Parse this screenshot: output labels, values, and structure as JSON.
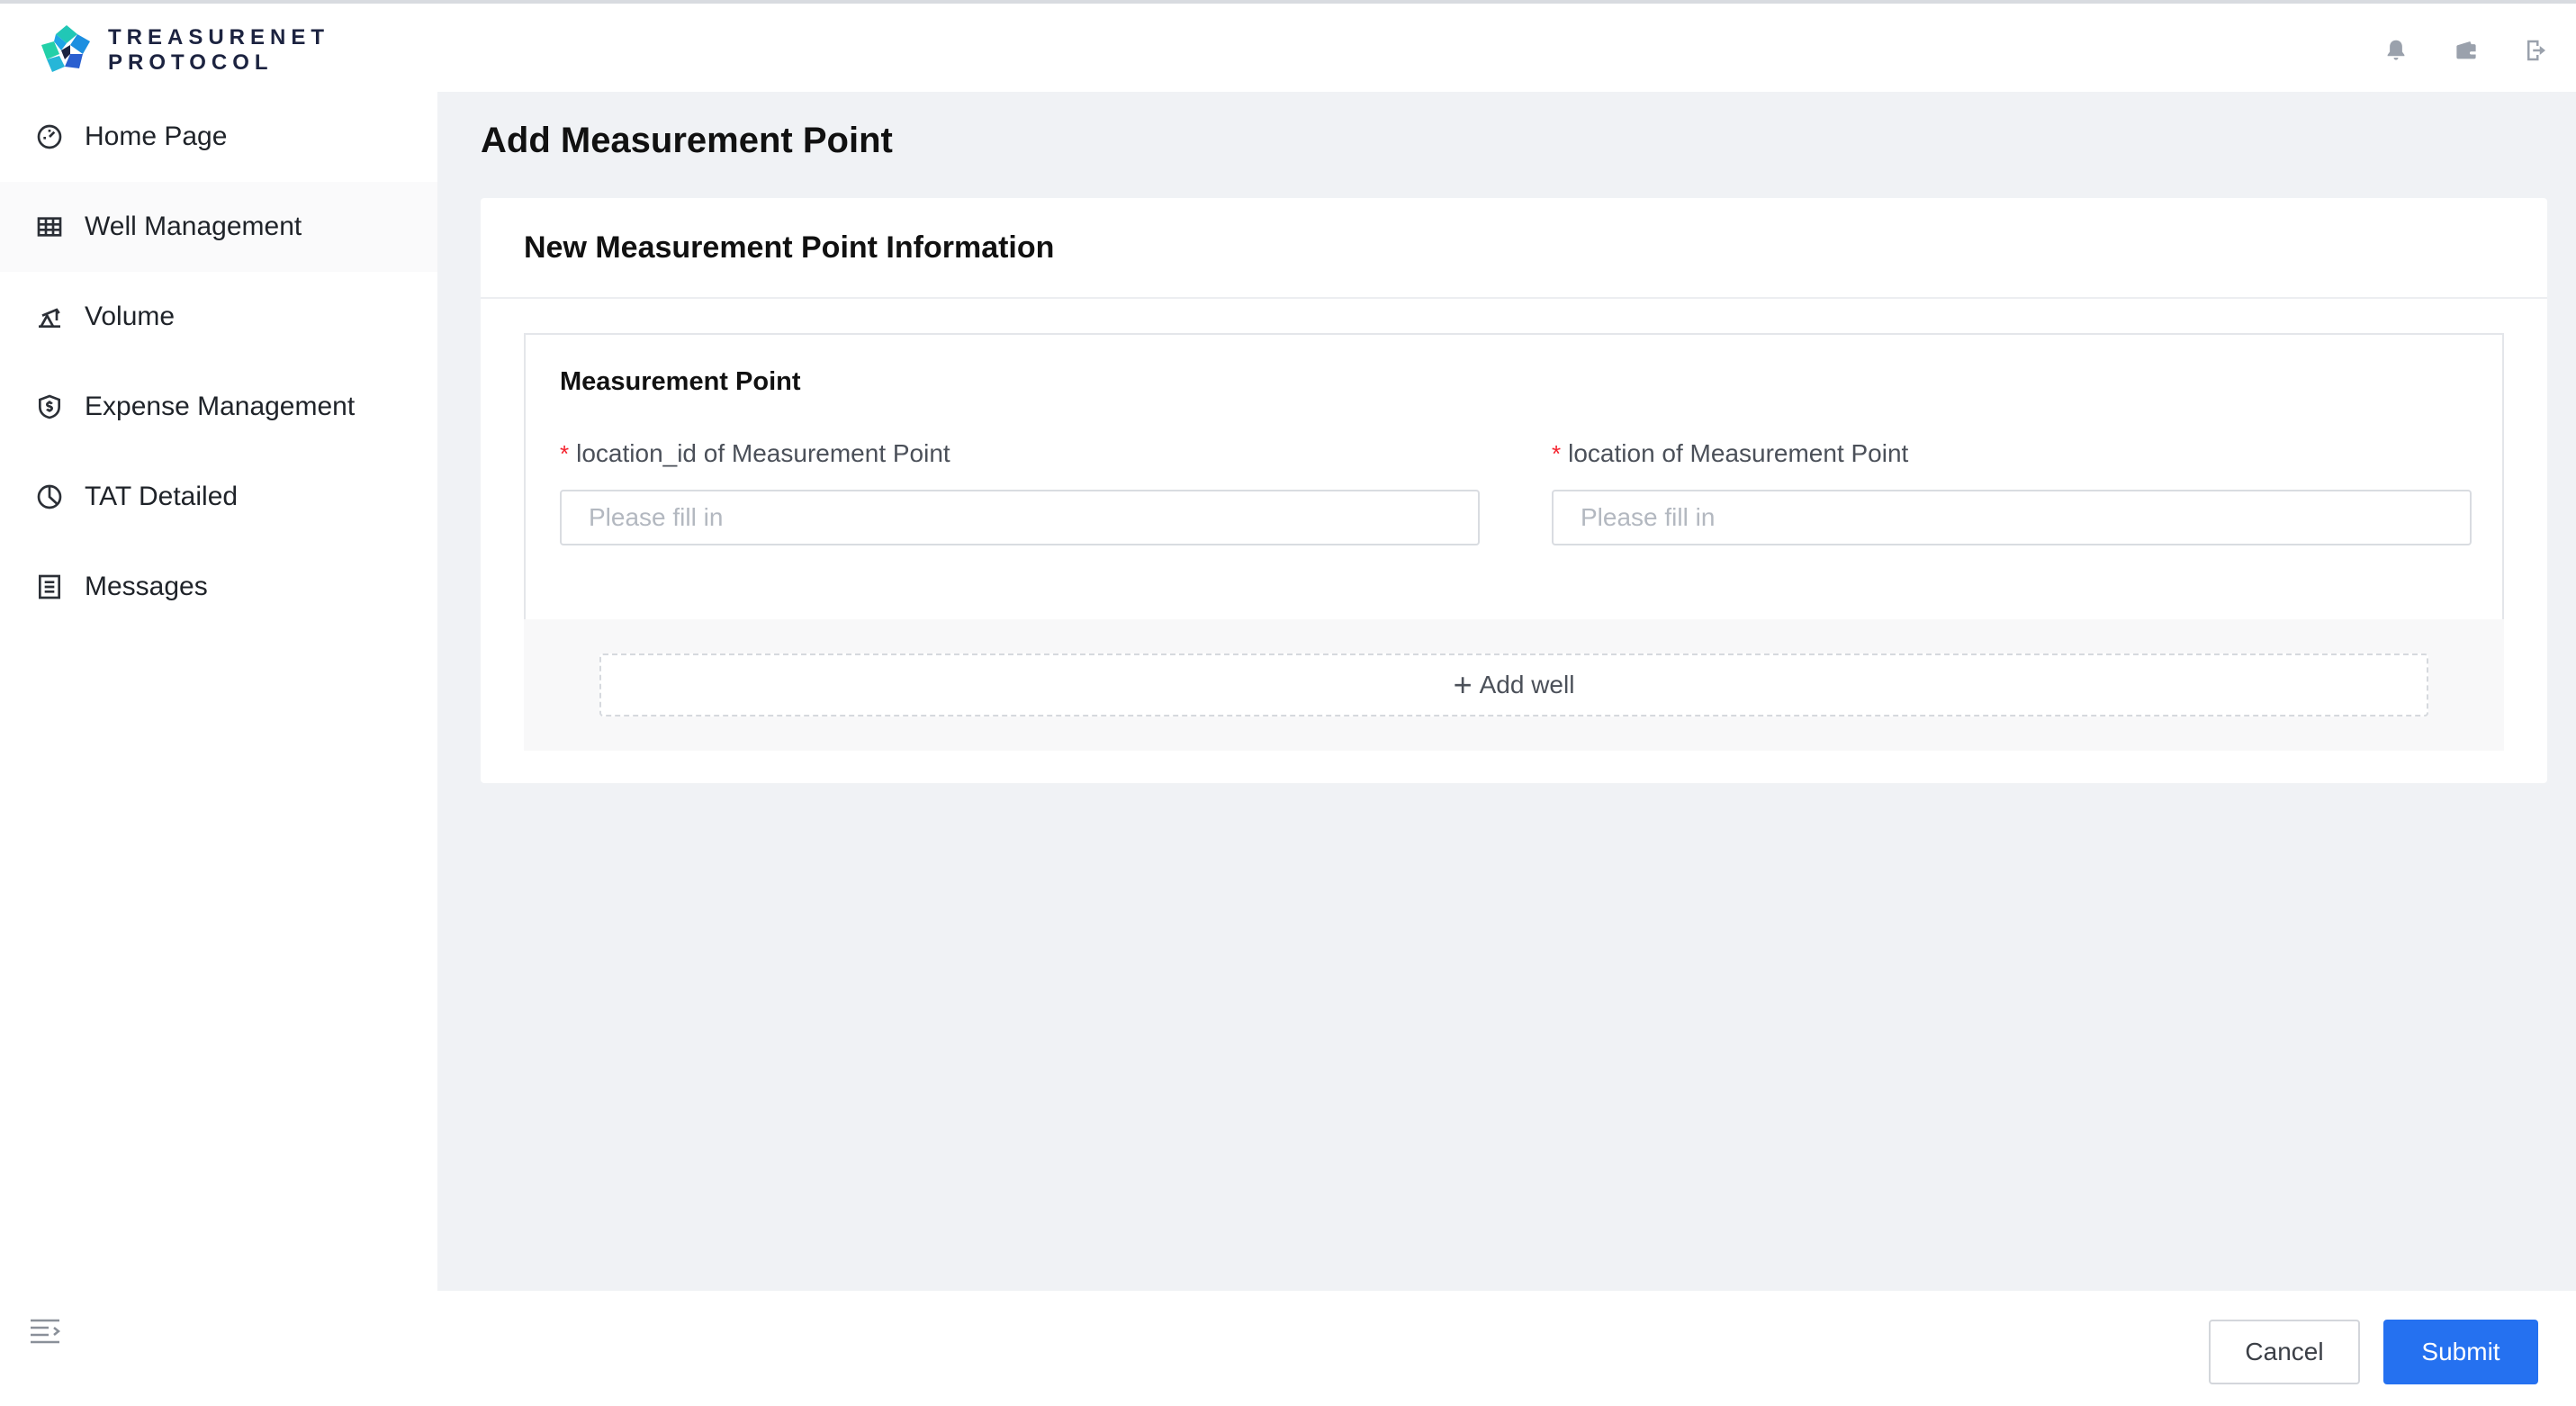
{
  "app": {
    "logo_line1": "TREASURENET",
    "logo_line2": "PROTOCOL",
    "brand_color": "#2571f0"
  },
  "header": {
    "icons": [
      "bell-icon",
      "wallet-icon",
      "logout-icon"
    ]
  },
  "sidebar": {
    "items": [
      {
        "label": "Home Page",
        "icon": "speedometer-icon"
      },
      {
        "label": "Well Management",
        "icon": "table-icon"
      },
      {
        "label": "Volume",
        "icon": "pumpjack-icon"
      },
      {
        "label": "Expense Management",
        "icon": "shield-dollar-icon"
      },
      {
        "label": "TAT Detailed",
        "icon": "pie-chart-icon"
      },
      {
        "label": "Messages",
        "icon": "list-icon"
      }
    ],
    "active_index": 1,
    "collapse_icon": "menu-collapse-icon"
  },
  "main": {
    "page_title": "Add Measurement Point",
    "card_title": "New Measurement Point Information",
    "section_title": "Measurement Point",
    "fields": [
      {
        "label": "location_id of Measurement Point",
        "placeholder": "Please fill in",
        "value": "",
        "required": true
      },
      {
        "label": "location of Measurement Point",
        "placeholder": "Please fill in",
        "value": "",
        "required": true
      }
    ],
    "required_marker": "*",
    "add_well_label": "Add well",
    "add_well_icon": "plus-icon"
  },
  "footer": {
    "cancel_label": "Cancel",
    "submit_label": "Submit"
  }
}
